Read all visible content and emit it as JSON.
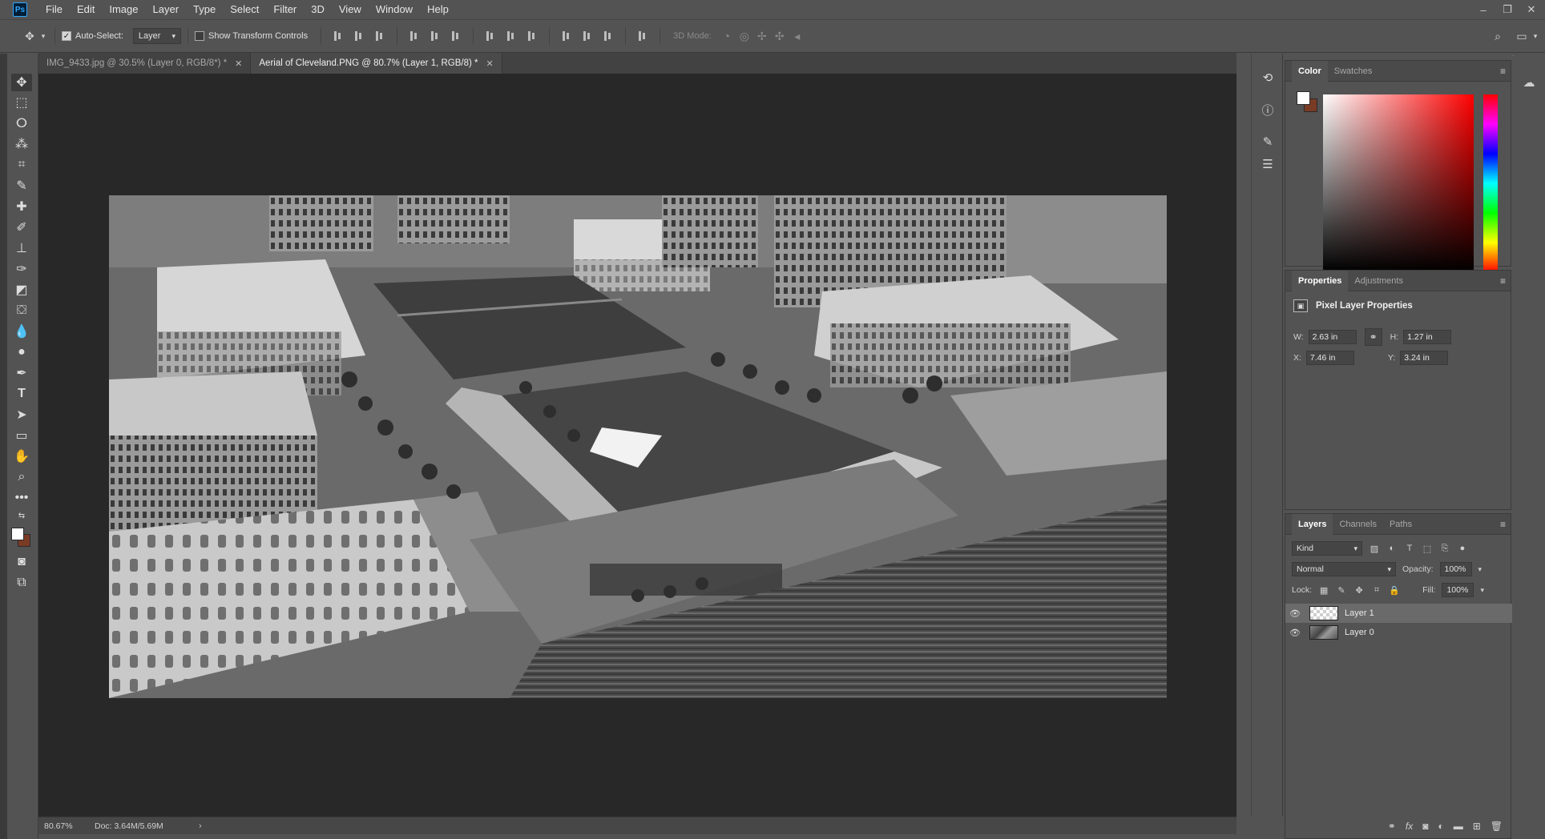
{
  "app": {
    "logo": "Ps"
  },
  "menu": [
    "File",
    "Edit",
    "Image",
    "Layer",
    "Type",
    "Select",
    "Filter",
    "3D",
    "View",
    "Window",
    "Help"
  ],
  "window_controls": {
    "minimize": "–",
    "restore": "❐",
    "close": "✕"
  },
  "options_bar": {
    "auto_select_label": "Auto-Select:",
    "auto_select_checked": true,
    "auto_select_target": "Layer",
    "show_transform_label": "Show Transform Controls",
    "show_transform_checked": false,
    "mode_label": "3D Mode:"
  },
  "tabs": [
    {
      "title": "IMG_9433.jpg @ 30.5% (Layer 0, RGB/8*) *",
      "active": false
    },
    {
      "title": "Aerial of Cleveland.PNG @ 80.7% (Layer 1, RGB/8) *",
      "active": true
    }
  ],
  "status": {
    "zoom": "80.67%",
    "doc": "Doc: 3.64M/5.69M"
  },
  "colors": {
    "foreground": "#ffffff",
    "background": "#7a3b25",
    "accent": "#31a8ff"
  },
  "color_panel": {
    "tabs": [
      "Color",
      "Swatches"
    ]
  },
  "properties": {
    "tabs": [
      "Properties",
      "Adjustments"
    ],
    "title": "Pixel Layer Properties",
    "w_label": "W:",
    "w": "2.63 in",
    "h_label": "H:",
    "h": "1.27 in",
    "x_label": "X:",
    "x": "7.46 in",
    "y_label": "Y:",
    "y": "3.24 in"
  },
  "layers": {
    "tabs": [
      "Layers",
      "Channels",
      "Paths"
    ],
    "kind_label": "Kind",
    "blend_mode": "Normal",
    "opacity_label": "Opacity:",
    "opacity": "100%",
    "lock_label": "Lock:",
    "fill_label": "Fill:",
    "fill": "100%",
    "items": [
      {
        "name": "Layer 1",
        "selected": true
      },
      {
        "name": "Layer 0",
        "selected": false
      }
    ]
  }
}
